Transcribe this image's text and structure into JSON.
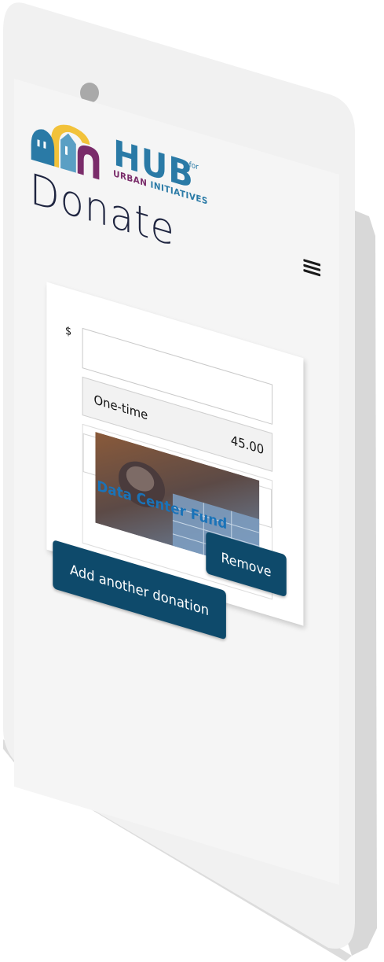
{
  "brand": {
    "name": "HUB",
    "for_text": "for",
    "subtitle_part1": "URBAN",
    "subtitle_part2": "INITIATIVES",
    "colors": {
      "blue": "#2a7aa6",
      "purple": "#7a2c6a",
      "yellow": "#f2c23a"
    }
  },
  "header": {
    "title": "Donate",
    "menu_icon": "hamburger-menu-icon"
  },
  "donation": {
    "currency_symbol": "$",
    "amount_value": "",
    "frequency_label": "One-time",
    "frequency_amount": "45.00",
    "fund": {
      "name": "Data Center Fund",
      "image_icon": "data-center-fund-image"
    },
    "remove_label": "Remove"
  },
  "actions": {
    "add_another_label": "Add another donation"
  },
  "theme": {
    "button_color": "#0e4a6b",
    "fund_link_color": "#1a73b8",
    "title_color": "#1f2540"
  }
}
